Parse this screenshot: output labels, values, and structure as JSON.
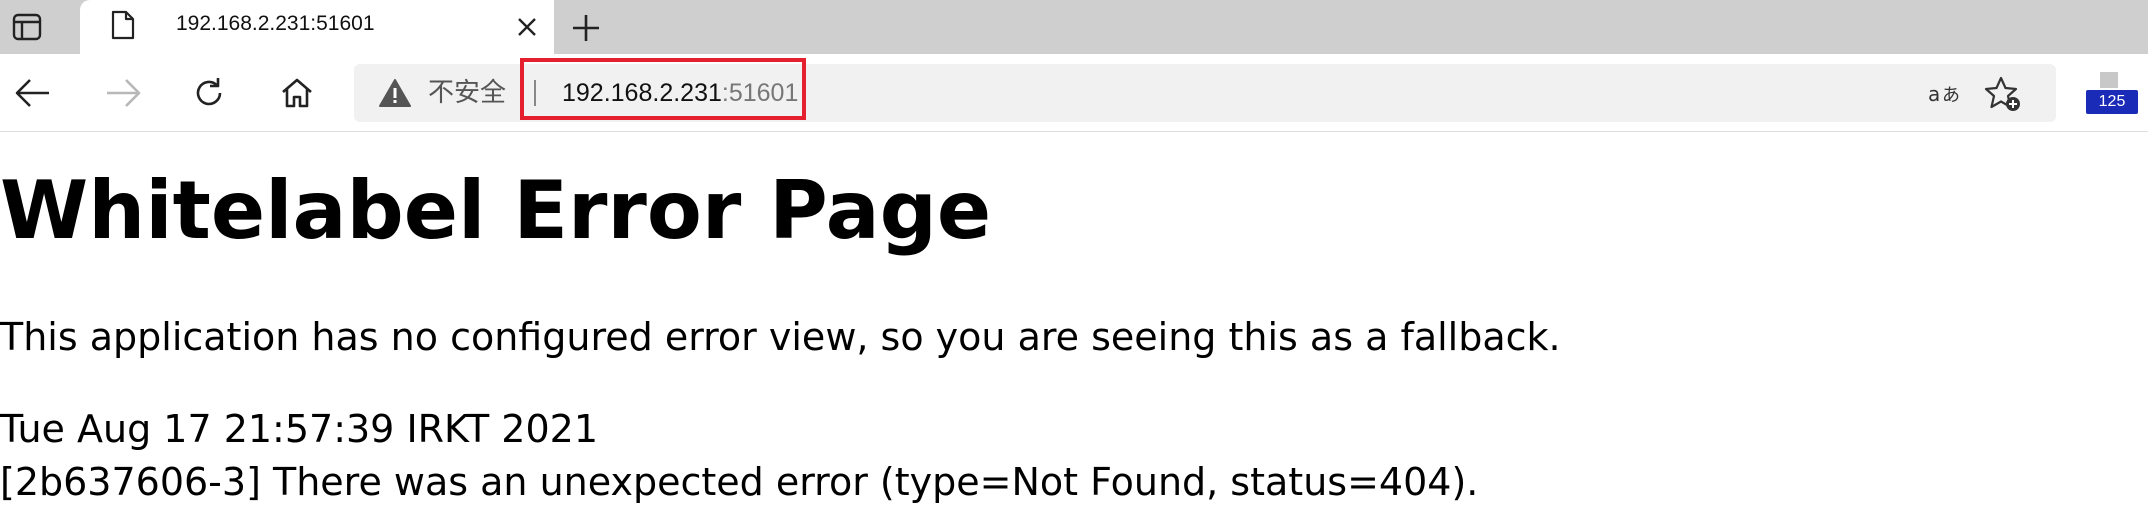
{
  "browser": {
    "tab": {
      "title": "192.168.2.231:51601"
    },
    "address_bar": {
      "security_label": "不安全",
      "host": "192.168.2.231",
      "port": ":51601"
    },
    "extension_badge": "125",
    "icons": {
      "tab_actions": "tab-actions-icon",
      "favicon": "page-icon",
      "close": "close-icon",
      "new_tab": "plus-icon",
      "back": "back-arrow-icon",
      "forward": "forward-arrow-icon",
      "refresh": "refresh-icon",
      "home": "home-icon",
      "security": "warning-icon",
      "read_aloud": "read-aloud-icon",
      "favorites": "add-favorite-icon",
      "extension": "extension-icon"
    },
    "colors": {
      "highlight": "#e5202e",
      "badge": "#1a2bb8"
    }
  },
  "page": {
    "title": "Whitelabel Error Page",
    "message": "This application has no configured error view, so you are seeing this as a fallback.",
    "timestamp": "Tue Aug 17 21:57:39 IRKT 2021",
    "error_line": "[2b637606-3] There was an unexpected error (type=Not Found, status=404)."
  }
}
